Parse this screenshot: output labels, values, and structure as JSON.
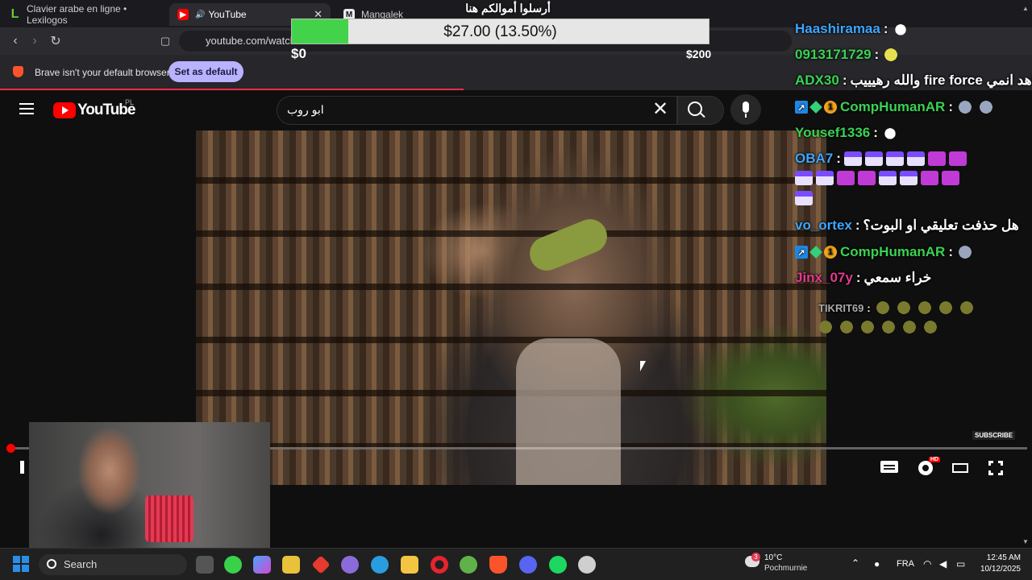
{
  "browser": {
    "tabs": [
      {
        "label": "Clavier arabe en ligne • Lexilogos",
        "icon": "L"
      },
      {
        "label": "YouTube",
        "icon": "▶",
        "audio_icon": "🔊",
        "close": "✕"
      },
      {
        "label": "Mangalek",
        "icon": "M"
      }
    ],
    "url": "youtube.com/watch?",
    "infobar": {
      "text": "Brave isn't your default browser",
      "button": "Set as default"
    }
  },
  "donation": {
    "title": "أرسلوا أموالكم هنا",
    "progress_text": "$27.00 (13.50%)",
    "progress_fraction": 0.135,
    "min_label": "$0",
    "max_label": "$200"
  },
  "youtube": {
    "logo_text": "YouTube",
    "region": "PL",
    "search_value": "ابو روب",
    "clear_icon": "✕",
    "subscribe_watermark": "SUBSCRIBE",
    "hd_badge": "HD",
    "progress_fraction": 0.003
  },
  "chat": {
    "messages": [
      {
        "user": "Haashiramaa",
        "color": "#3ea6ff",
        "text": "",
        "emotes": [
          "goose"
        ]
      },
      {
        "user": "0913171729",
        "color": "#39d353",
        "text": "",
        "emotes": [
          "face"
        ]
      },
      {
        "user": "ADX30",
        "color": "#39d353",
        "text": "والله رهيييب fire force شاهد انمي",
        "emotes": []
      },
      {
        "user": "CompHumanAR",
        "color": "#39d353",
        "text": "",
        "emotes": [
          "bird",
          "bird"
        ],
        "badges": true
      },
      {
        "user": "Yousef1336",
        "color": "#39d353",
        "text": "",
        "emotes": [
          "goose"
        ]
      },
      {
        "user": "OBA7",
        "color": "#3ea6ff",
        "text": "",
        "emotes": [
          "cat",
          "cat",
          "cat",
          "cat",
          "purple",
          "purple"
        ]
      },
      {
        "user": "",
        "color": "#3ea6ff",
        "text": "",
        "emotes": [
          "cat",
          "cat",
          "purple",
          "purple",
          "cat",
          "cat",
          "purple",
          "purple"
        ]
      },
      {
        "user": "",
        "color": "#3ea6ff",
        "text": "",
        "emotes": [
          "cat"
        ]
      },
      {
        "user": "vo_ortex",
        "color": "#3ea6ff",
        "text": "هل حذفت تعليقي او البوت؟",
        "emotes": []
      },
      {
        "user": "CompHumanAR",
        "color": "#39d353",
        "text": "",
        "emotes": [
          "bird"
        ],
        "badges": true
      },
      {
        "user": "Jinx_07y",
        "color": "#e23b8a",
        "text": "خراء سمعي",
        "emotes": []
      },
      {
        "user": "TIKRIT69",
        "color": "#aaaaaa",
        "text": "",
        "emotes": [
          "frog",
          "frog",
          "frog",
          "frog",
          "frog"
        ]
      },
      {
        "user": "",
        "color": "#aaaaaa",
        "text": "",
        "emotes": [
          "frog",
          "frog",
          "frog",
          "frog",
          "frog",
          "frog"
        ]
      }
    ]
  },
  "taskbar": {
    "search_label": "Search",
    "weather_temp": "10°C",
    "weather_desc": "Pochmurnie",
    "weather_badge": "3",
    "language": "FRA",
    "time": "12:45 AM",
    "date": "10/12/2025"
  }
}
